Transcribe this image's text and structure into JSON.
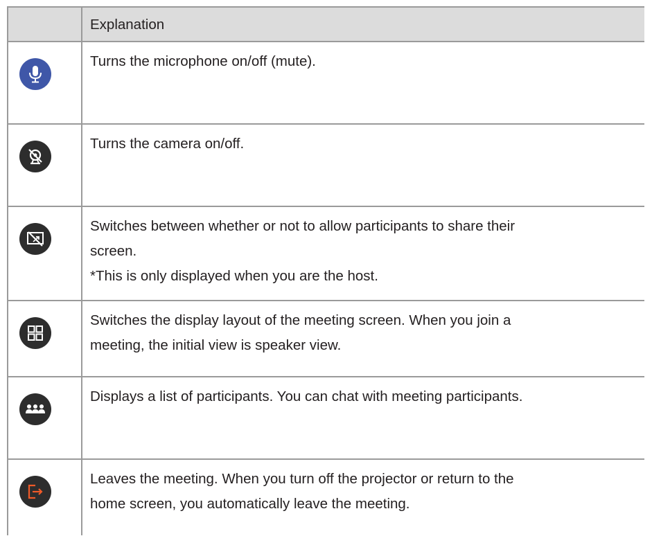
{
  "table": {
    "header": {
      "icon_col": "",
      "explanation_col": "Explanation"
    },
    "rows": [
      {
        "icon": "microphone-icon",
        "icon_bg": "#3f57a8",
        "lines": [
          "Turns the microphone on/off (mute)."
        ]
      },
      {
        "icon": "camera-off-icon",
        "icon_bg": "#2d2d2d",
        "lines": [
          "Turns the camera on/off."
        ]
      },
      {
        "icon": "screen-share-off-icon",
        "icon_bg": "#2d2d2d",
        "lines": [
          "Switches between whether or not to allow participants to share their",
          "screen.",
          "*This is only displayed when you are the host."
        ]
      },
      {
        "icon": "layout-grid-icon",
        "icon_bg": "#2d2d2d",
        "lines": [
          "Switches the display layout of the meeting screen. When you join a",
          "meeting, the initial view is speaker view."
        ]
      },
      {
        "icon": "participants-icon",
        "icon_bg": "#2d2d2d",
        "lines": [
          "Displays a list of participants. You can chat with meeting participants."
        ]
      },
      {
        "icon": "leave-meeting-icon",
        "icon_bg": "#2d2d2d",
        "icon_accent": "#f05a28",
        "lines": [
          "Leaves the meeting. When you turn off the projector or return to the",
          "home screen, you automatically leave the meeting."
        ]
      }
    ]
  }
}
